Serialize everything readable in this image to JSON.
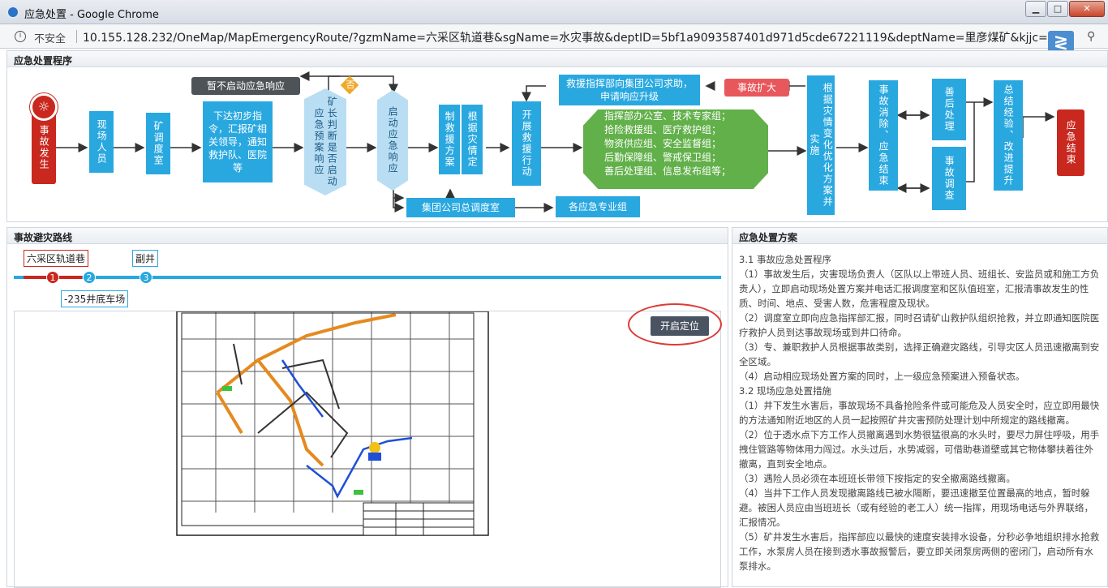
{
  "window": {
    "title": "应急处置 - Google Chrome",
    "buttons": {
      "min": "▁",
      "max": "□",
      "close": "✕"
    }
  },
  "addressbar": {
    "security": "不安全",
    "url": "10.155.128.232/OneMap/MapEmergencyRoute/?gzmName=六采区轨道巷&sgName=水灾事故&deptID=5bf1a9093587401d971d5cde67221119&deptName=里彦煤矿&kjjc=LYK",
    "zoom_icon": "search-icon"
  },
  "process": {
    "header": "应急处置程序",
    "incident": "事故发生",
    "site_staff": "现场人员",
    "dispatch_room": "矿调度室",
    "initial_orders": "下达初步指令，汇报矿相关领导，通知救护队、医院等",
    "no_response": "暂不启动应急响应",
    "no_label": "否",
    "mine_judge": "矿长判断是否启动应急预案响应",
    "start_response": "启动应急响应",
    "make_plan": "制救援方案",
    "by_disaster": "根据灾情定",
    "deploy_rescue": "开展救援行动",
    "ask_upgrade": "救援指挥部向集团公司求助，申请响应升级",
    "escalation": "事故扩大",
    "groups": [
      "指挥部办公室、技术专家组；",
      "抢险救援组、医疗救护组；",
      "物资供应组、安全监督组；",
      "后勤保障组、警戒保卫组；",
      "善后处理组、信息发布组等；"
    ],
    "adjust_plan": "根据灾情变化优化方案并实施",
    "eliminated": "事故消除、应急结束",
    "aftermath": "善后处理",
    "investigation": "事故调查",
    "summary": "总结经验、改进提升",
    "end": "应急结束",
    "group_dispatch": "集团公司总调度室",
    "pro_teams": "各应急专业组"
  },
  "route": {
    "header": "事故避灾路线",
    "stops": [
      {
        "num": "1",
        "name": "六采区轨道巷"
      },
      {
        "num": "2",
        "name": "-235井底车场"
      },
      {
        "num": "3",
        "name": "副井"
      }
    ],
    "locate_button": "开启定位"
  },
  "plan": {
    "header": "应急处置方案",
    "paragraphs": [
      "3.1 事故应急处置程序",
      "（1）事故发生后，灾害现场负责人（区队以上带班人员、班组长、安监员或和施工方负责人），立即启动现场处置方案并电话汇报调度室和区队值班室，汇报清事故发生的性质、时间、地点、受害人数，危害程度及现状。",
      "（2）调度室立即向应急指挥部汇报，同时召请矿山救护队组织抢救，并立即通知医院医疗救护人员到达事故现场或到井口待命。",
      "（3）专、兼职救护人员根据事故类别，选择正确避灾路线，引导灾区人员迅速撤离到安全区域。",
      "（4）启动相应现场处置方案的同时，上一级应急预案进入预备状态。",
      "3.2 现场应急处置措施",
      "（1）井下发生水害后，事故现场不具备抢险条件或可能危及人员安全时，应立即用最快的方法通知附近地区的人员一起按照矿井灾害预防处理计划中所规定的路线撤离。",
      "（2）位于透水点下方工作人员撤离遇到水势很猛很高的水头时，要尽力屏住呼吸，用手拽住管路等物体用力闯过。水头过后，水势减弱，可借助巷道壁或其它物体攀扶着往外撤离，直到安全地点。",
      "（3）遇险人员必须在本班班长带领下按指定的安全撤离路线撤离。",
      "（4）当井下工作人员发现撤离路线已被水隔断，要迅速撤至位置最高的地点，暂时躲避。被困人员应由当班班长（或有经验的老工人）统一指挥，用现场电话与外界联络，汇报情况。",
      "（5）矿井发生水害后，指挥部应以最快的速度安装排水设备，分秒必争地组织排水抢救工作，水泵房人员在接到透水事故报警后，要立即关闭泵房两侧的密闭门，启动所有水泵排水。"
    ]
  },
  "colors": {
    "accent": "#29a8e0",
    "alert": "#c9281e",
    "group": "#62b04a",
    "gray": "#4e5358",
    "decision": "#f0a92b"
  }
}
